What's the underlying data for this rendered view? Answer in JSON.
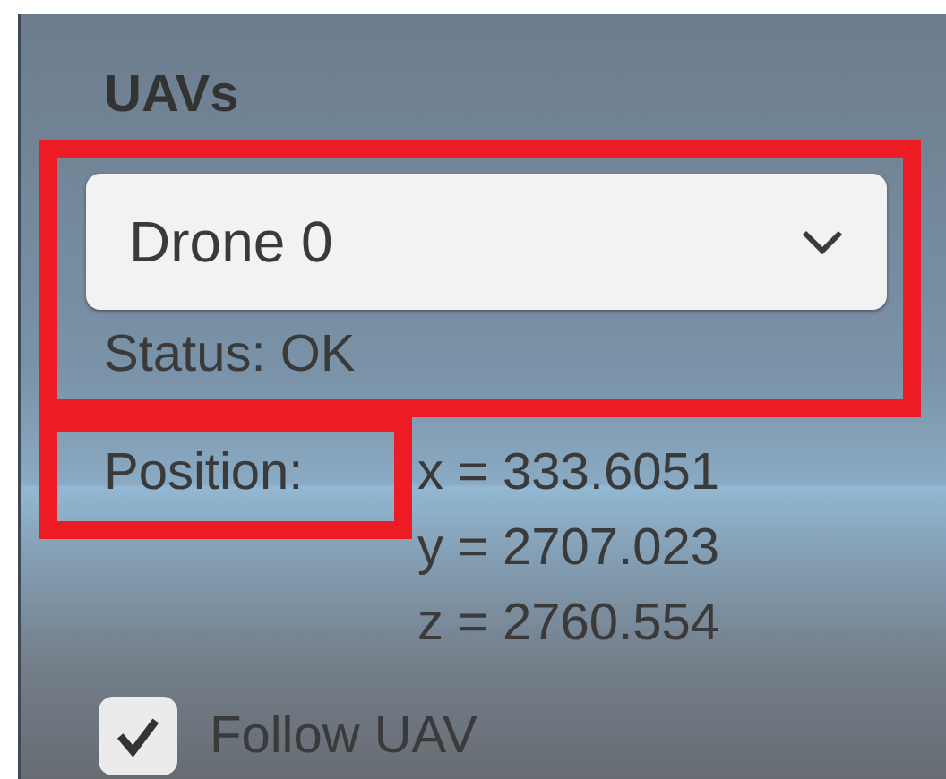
{
  "panel": {
    "title": "UAVs",
    "selector": {
      "value": "Drone 0",
      "highlighted": true
    },
    "status": "Status: OK",
    "position": {
      "label": "Position:",
      "highlighted": true,
      "values": [
        "x = 333.6051",
        "y = 2707.023",
        "z = 2760.554"
      ]
    },
    "follow": {
      "label": "Follow UAV",
      "checked": true
    }
  }
}
